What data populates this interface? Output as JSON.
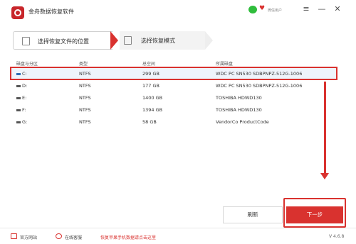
{
  "app": {
    "title": "金舟数据恢复软件",
    "login": "微信用户",
    "menu_icon": "≡",
    "min_icon": "—",
    "close_icon": "✕"
  },
  "steps": [
    {
      "label": "选择恢复文件的位置",
      "active": true
    },
    {
      "label": "选择恢复模式",
      "active": false
    }
  ],
  "table": {
    "headers": [
      "磁盘与分区",
      "类型",
      "总空间",
      "所属磁盘"
    ],
    "rows": [
      {
        "drive": "C:",
        "type": "NTFS",
        "size": "299 GB",
        "disk": "WDC PC SN530 SDBPNPZ-512G-1006",
        "selected": true
      },
      {
        "drive": "D:",
        "type": "NTFS",
        "size": "177 GB",
        "disk": "WDC PC SN530 SDBPNPZ-512G-1006",
        "selected": false
      },
      {
        "drive": "E:",
        "type": "NTFS",
        "size": "1400 GB",
        "disk": "TOSHIBA HDWD130",
        "selected": false
      },
      {
        "drive": "F:",
        "type": "NTFS",
        "size": "1394 GB",
        "disk": "TOSHIBA HDWD130",
        "selected": false
      },
      {
        "drive": "G:",
        "type": "NTFS",
        "size": "58 GB",
        "disk": "VendorCo ProductCode",
        "selected": false
      }
    ]
  },
  "buttons": {
    "refresh": "刷新",
    "next": "下一步"
  },
  "footer": {
    "site": "官方网站",
    "service": "在线客服",
    "tip": "恢复苹果手机数据请点击这里",
    "version": "V 4.6.8"
  },
  "colors": {
    "accent": "#d9322f",
    "selected_row": "#eef4fb"
  }
}
